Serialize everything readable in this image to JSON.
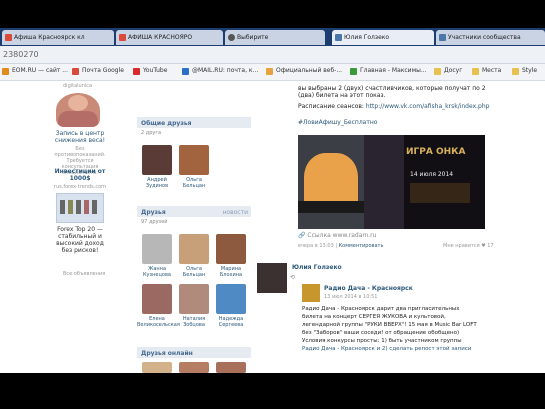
{
  "tabs": [
    {
      "label": "Афиша Красноярск кл",
      "color": "#d94a3a"
    },
    {
      "label": "АФИША КРАСНОЯРО",
      "color": "#d94a3a"
    },
    {
      "label": "Выбирите",
      "color": "#555"
    },
    {
      "label": "Юлия Голзеко",
      "color": "#4a76a8"
    },
    {
      "label": "Участники сообщества",
      "color": "#4a76a8"
    }
  ],
  "address": "2380270",
  "bookmarks": [
    {
      "label": "ЕОМ.RU — сайт ...",
      "color": "#e28a1a"
    },
    {
      "label": "Почта Google",
      "color": "#d94a3a"
    },
    {
      "label": "YouTube",
      "color": "#d92b2b"
    },
    {
      "label": "@MAIL.RU: почта, к...",
      "color": "#2a6fc9"
    },
    {
      "label": "Официальный веб-...",
      "color": "#e8a23c"
    },
    {
      "label": "Главная - Максимы...",
      "color": "#3a9a3a"
    },
    {
      "label": "Досуг",
      "color": "#e8c050"
    },
    {
      "label": "Места",
      "color": "#e8c050"
    },
    {
      "label": "Style",
      "color": "#e8c050"
    }
  ],
  "left": {
    "user": "digitalunica",
    "promo_title": "Запись в центр снижения веса!",
    "promo_text": "Без противопоказаний. Требуется консультация специалиста.",
    "invest_title": "Инвестиции от 1000$",
    "invest_site": "rus.forex-trends.com",
    "forex_text": "Forex Top 20 — стабильный и высокий доход без рисков!",
    "all_ads": "Все объявления"
  },
  "groups": {
    "common_title": "Общие друзья",
    "common_count": "2 друга",
    "common": [
      {
        "first": "Андрей",
        "last": "Зудинов"
      },
      {
        "first": "Ольга",
        "last": "Бельцан"
      }
    ],
    "friends_title": "Друзья",
    "friends_right": "новости",
    "friends_count": "97 друзей",
    "friends": [
      {
        "first": "Жанна",
        "last": "Кузнецова"
      },
      {
        "first": "Ольга",
        "last": "Бельцан"
      },
      {
        "first": "Марина",
        "last": "Блохина"
      },
      {
        "first": "Елена",
        "last": "Великосельская"
      },
      {
        "first": "Наталия",
        "last": "Зобцова"
      },
      {
        "first": "Надежда",
        "last": "Сергеева"
      }
    ],
    "online_title": "Друзья онлайн"
  },
  "post": {
    "line1": "вы выбраны 2 (двух) счастливчиков, которые получат по 2 (два) билета на этот показ.",
    "line2_label": "Расписание сеансов:",
    "line2_link": "http://www.vk.com/afisha_krsk/index.php",
    "hashtag": "#ЛовиАфишу_Бесплатно",
    "poster_title": "ИГРА ОНКА",
    "poster_date": "14 июля 2014",
    "link_caption": "Ссылка www.radam.ru",
    "meta_left": "вчера в 13:03",
    "meta_mid": "Комментировать",
    "meta_right": "Мне нравится",
    "likes": "17"
  },
  "wall": {
    "author": "Юлия Голзеко",
    "repost_group": "Радио Дача - Красноярск",
    "repost_date": "13 июл 2014 в 10:51",
    "t1": "Радио Дача - Красноярск дарит два пригласительных",
    "t2": "билета на концерт СЕРГЕЯ ЖУКОВА и культовой,",
    "t3": "легендарной группы \"РУКИ ВВЕРХ\"! 15 мая в Music Bar LOFT",
    "t4": "без \"Заборов\" ваши соседи! от обращение обобщено)",
    "t5": "Условия конкурсы просты: 1) быть участником группы",
    "t6": "Радио Дача - Красноярск и 2) сделать репост этой записи"
  }
}
